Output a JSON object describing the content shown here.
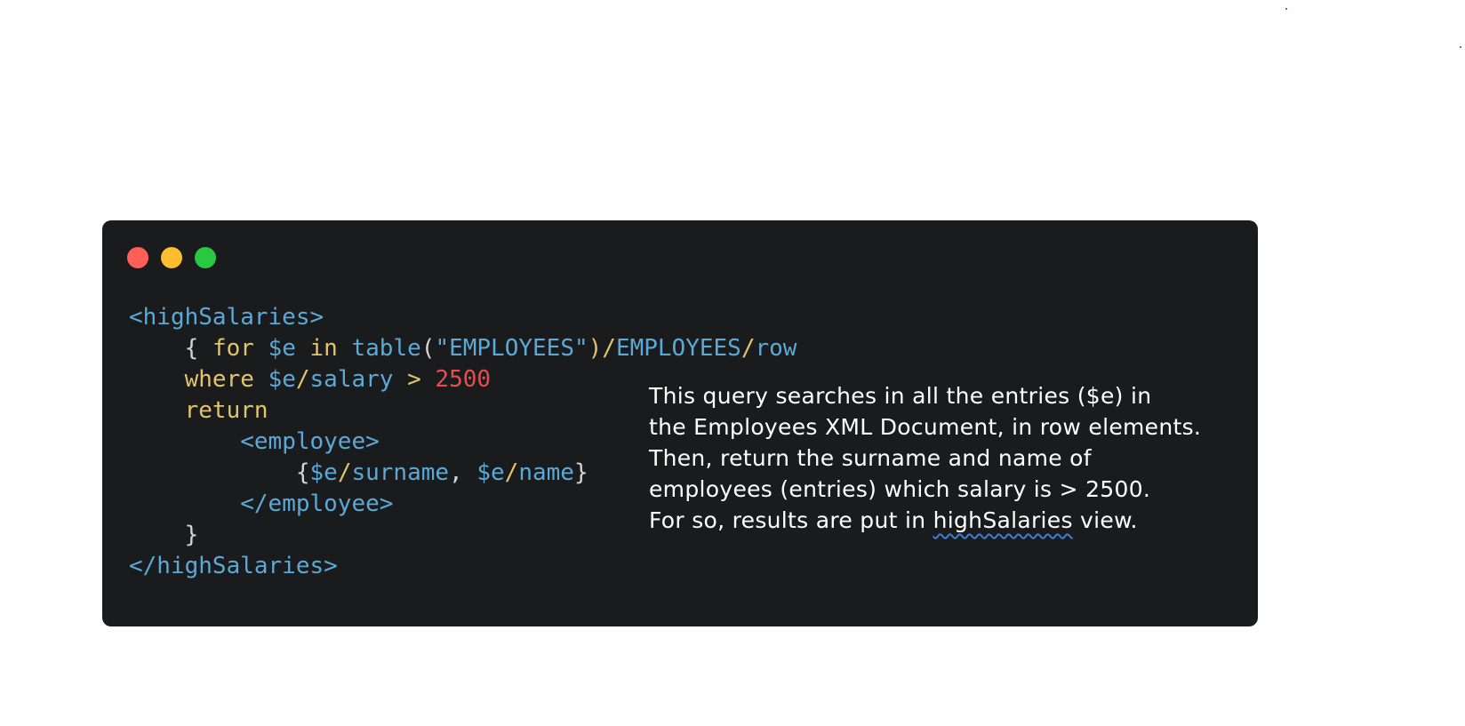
{
  "window": {
    "controls": [
      {
        "name": "close",
        "color": "#ff5f57"
      },
      {
        "name": "minimize",
        "color": "#febc2e"
      },
      {
        "name": "maximize",
        "color": "#28c840"
      }
    ]
  },
  "code": {
    "l1": {
      "open_tag": "<highSalaries>"
    },
    "l2": {
      "indent": "    ",
      "brace": "{ ",
      "for_kw": "for",
      "var": "$e",
      "in_kw": "in",
      "fn": "table",
      "paren_open": "(",
      "str": "\"EMPLOYEES\"",
      "paren_close": ")",
      "slash1": "/",
      "path1": "EMPLOYEES",
      "slash2": "/",
      "path2": "row"
    },
    "l3": {
      "indent": "    ",
      "where_kw": "where",
      "var": "$e",
      "slash": "/",
      "field": "salary",
      "op": ">",
      "num": "2500"
    },
    "l4": {
      "indent": "    ",
      "return_kw": "return"
    },
    "l5": {
      "indent": "        ",
      "open_tag": "<employee>"
    },
    "l6": {
      "indent": "            ",
      "brace_open": "{",
      "var1": "$e",
      "slash1": "/",
      "field1": "surname",
      "comma": ", ",
      "var2": "$e",
      "slash2": "/",
      "field2": "name",
      "brace_close": "}"
    },
    "l7": {
      "indent": "        ",
      "close_tag": "</employee>"
    },
    "l8": {
      "indent": "    ",
      "brace": "}"
    },
    "l9": {
      "close_tag": "</highSalaries>"
    }
  },
  "note": {
    "line1": "This query searches in all the entries ($e) in",
    "line2": "the Employees XML Document, in row elements.",
    "line3": "Then, return the surname and name of",
    "line4": "employees (entries) which salary is > 2500.",
    "line5_pre": "For so, results are put in ",
    "line5_emph": "highSalaries",
    "line5_post": " view."
  },
  "colors": {
    "window_bg": "#1a1b1d",
    "tag": "#5aa9d6",
    "keyword": "#e2c46a",
    "number": "#e0504f",
    "plain": "#d4d4d4",
    "annotation_text": "#ffffff",
    "squiggle": "#3d7fd6"
  }
}
